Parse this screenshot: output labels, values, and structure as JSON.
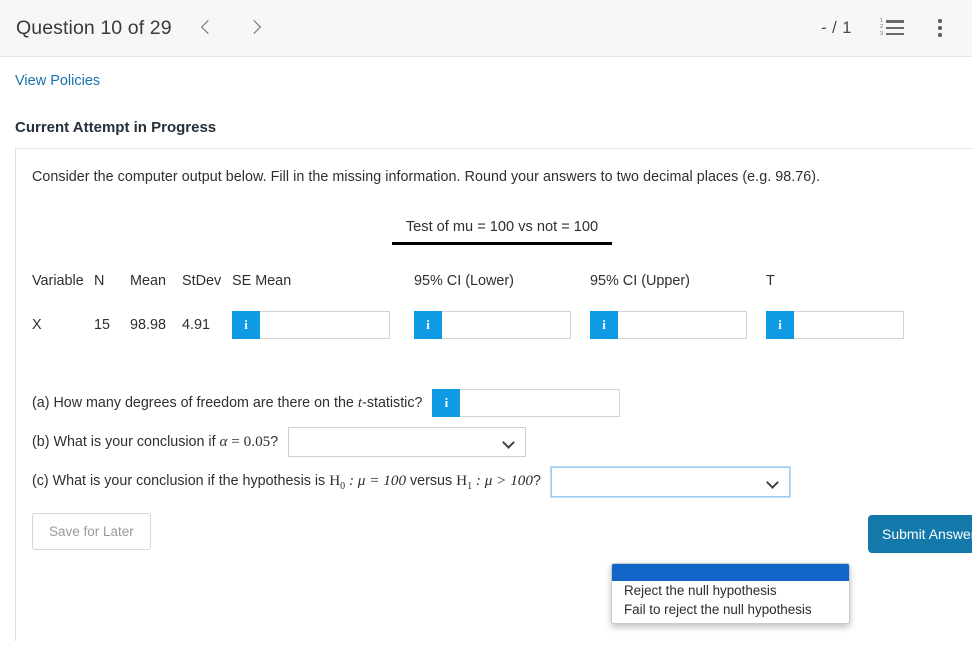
{
  "header": {
    "question_title": "Question 10 of 29",
    "prev_label": "‹",
    "next_label": "›",
    "score": "- / 1",
    "list_icon_nums": [
      "1",
      "2",
      "3"
    ]
  },
  "policies": {
    "link_label": "View Policies"
  },
  "attempt": {
    "heading": "Current Attempt in Progress"
  },
  "intro": "Consider the computer output below. Fill in the missing information. Round your answers to two decimal places (e.g. 98.76).",
  "output": {
    "title": "Test of mu = 100 vs not = 100",
    "headers": {
      "variable": "Variable",
      "n": "N",
      "mean": "Mean",
      "stdev": "StDev",
      "se_mean": "SE Mean",
      "ci_lower": "95% CI (Lower)",
      "ci_upper": "95% CI (Upper)",
      "t": "T"
    },
    "row": {
      "variable": "X",
      "n": "15",
      "mean": "98.98",
      "stdev": "4.91",
      "se_mean_value": "",
      "ci_lower_value": "",
      "ci_upper_value": "",
      "t_value": ""
    },
    "info_icon_label": "i"
  },
  "questions": {
    "a": {
      "text_before": "(a) How many degrees of freedom are there on the ",
      "math_t": "t",
      "text_after": "-statistic?",
      "value": "",
      "info_icon_label": "i"
    },
    "b": {
      "text_before": "(b) What is your conclusion if ",
      "math_alpha": "α",
      "math_eq": " = ",
      "math_val": "0.05",
      "text_after": "?",
      "selected": ""
    },
    "c": {
      "text_before": "(c) What is your conclusion if the hypothesis is ",
      "h0": "H",
      "h0_sub": "0",
      "h0_rest": " : μ  =  100",
      "versus": " versus ",
      "h1": "H",
      "h1_sub": "1",
      "h1_rest": " : μ  >  100",
      "text_after": "?",
      "selected": ""
    }
  },
  "dropdown": {
    "options": [
      "",
      "Reject the null hypothesis",
      "Fail to reject the null hypothesis"
    ],
    "blank_option": "",
    "option_1": "Reject the null hypothesis",
    "option_2": "Fail to reject the null hypothesis"
  },
  "footer": {
    "save_label": "Save for Later",
    "submit_label": "Submit Answer"
  },
  "colors": {
    "info_blue": "#0f9ae4",
    "submit_teal": "#1378aa",
    "link_blue": "#1a72ad",
    "highlight_blue": "#1266c8"
  }
}
